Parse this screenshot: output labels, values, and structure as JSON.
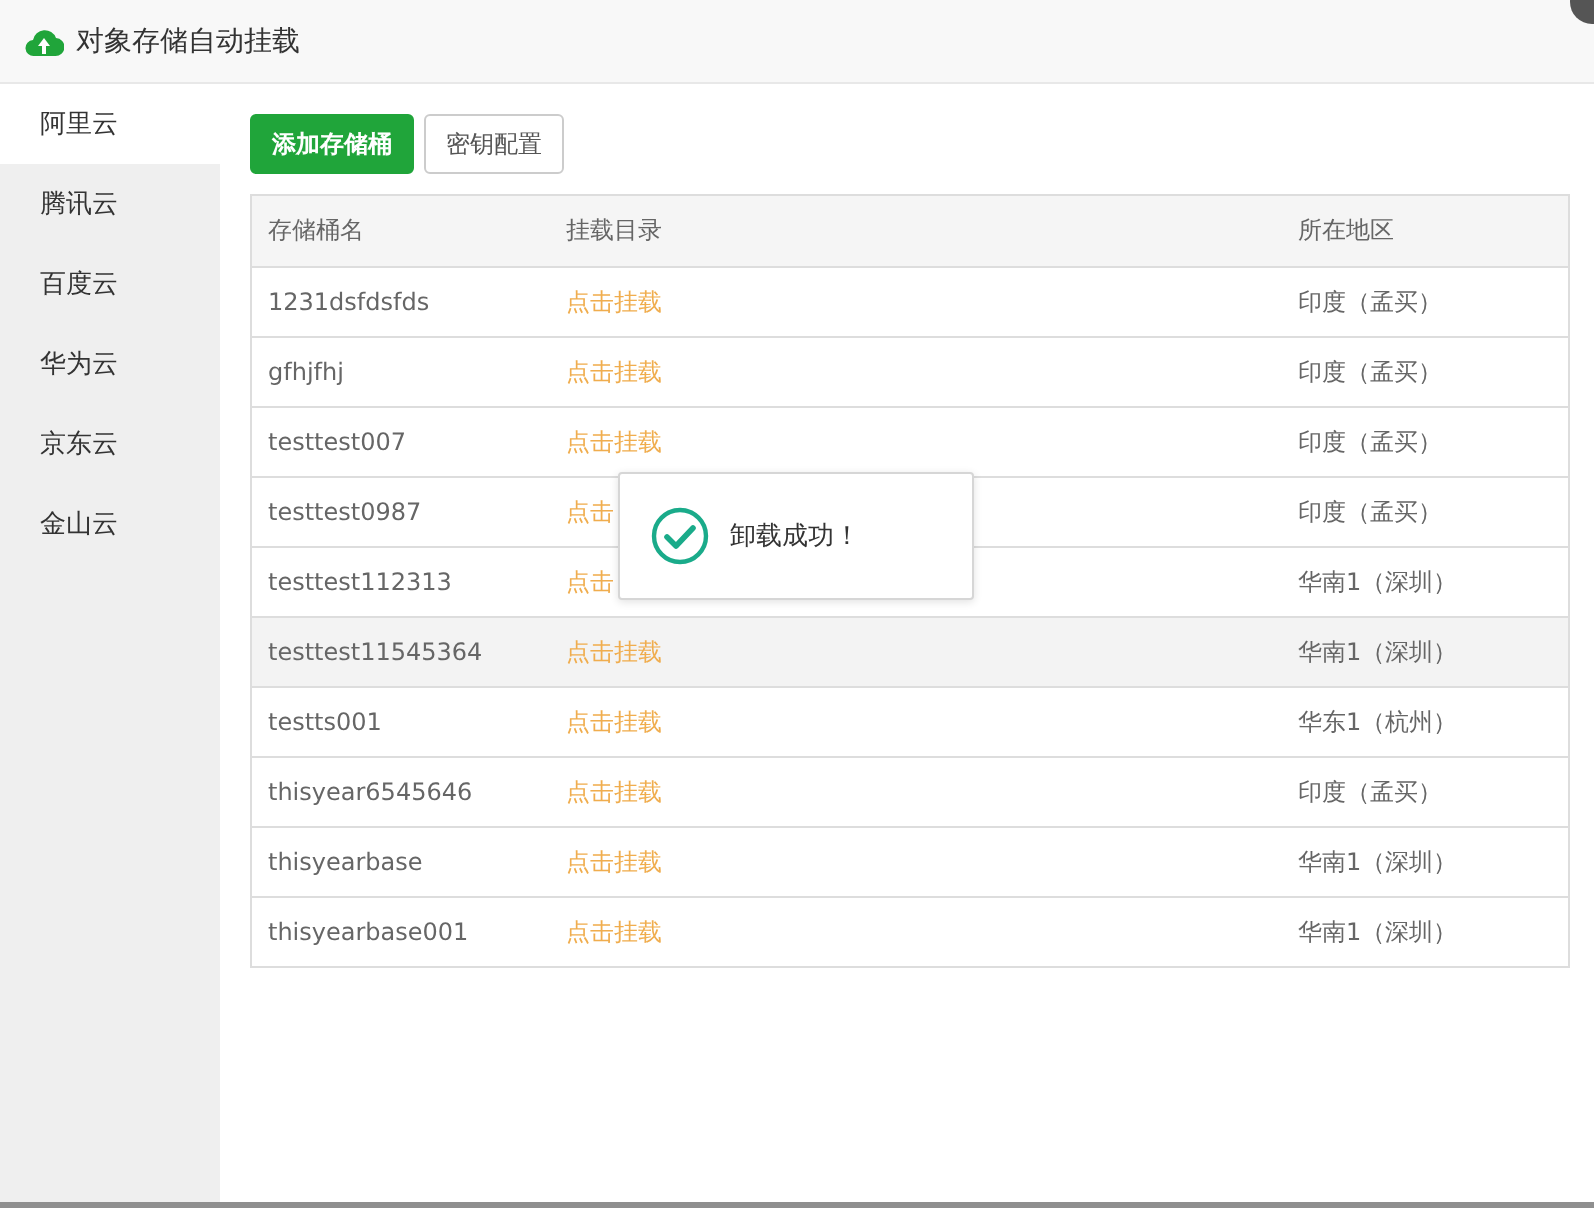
{
  "window": {
    "title": "对象存储自动挂载"
  },
  "sidebar": {
    "items": [
      {
        "label": "阿里云",
        "selected": true
      },
      {
        "label": "腾讯云",
        "selected": false
      },
      {
        "label": "百度云",
        "selected": false
      },
      {
        "label": "华为云",
        "selected": false
      },
      {
        "label": "京东云",
        "selected": false
      },
      {
        "label": "金山云",
        "selected": false
      }
    ]
  },
  "toolbar": {
    "buttons": [
      {
        "label": "添加存储桶",
        "kind": "primary"
      },
      {
        "label": "密钥配置",
        "kind": "default"
      }
    ]
  },
  "table": {
    "columns": [
      "存储桶名",
      "挂载目录",
      "所在地区"
    ],
    "rows": [
      {
        "name": "1231dsfdsfds",
        "mount": "点击挂载",
        "region": "印度（孟买）",
        "highlighted": false
      },
      {
        "name": "gfhjfhj",
        "mount": "点击挂载",
        "region": "印度（孟买）",
        "highlighted": false
      },
      {
        "name": "testtest007",
        "mount": "点击挂载",
        "region": "印度（孟买）",
        "highlighted": false
      },
      {
        "name": "testtest0987",
        "mount": "点击",
        "region": "印度（孟买）",
        "highlighted": false
      },
      {
        "name": "testtest112313",
        "mount": "点击",
        "region": "华南1（深圳）",
        "highlighted": false
      },
      {
        "name": "testtest11545364",
        "mount": "点击挂载",
        "region": "华南1（深圳）",
        "highlighted": true
      },
      {
        "name": "testts001",
        "mount": "点击挂载",
        "region": "华东1（杭州）",
        "highlighted": false
      },
      {
        "name": "thisyear6545646",
        "mount": "点击挂载",
        "region": "印度（孟买）",
        "highlighted": false
      },
      {
        "name": "thisyearbase",
        "mount": "点击挂载",
        "region": "华南1（深圳）",
        "highlighted": false
      },
      {
        "name": "thisyearbase001",
        "mount": "点击挂载",
        "region": "华南1（深圳）",
        "highlighted": false
      }
    ]
  },
  "toast": {
    "message": "卸载成功！"
  }
}
